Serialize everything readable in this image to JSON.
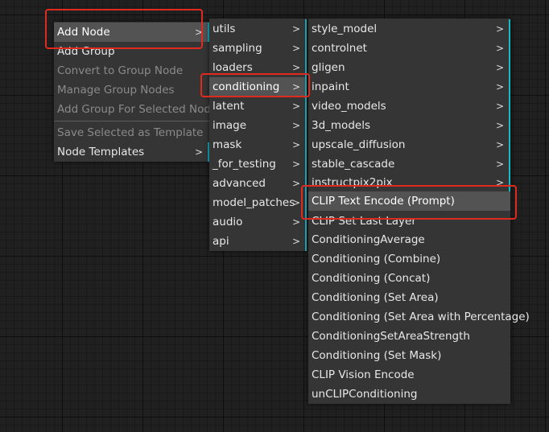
{
  "context_menu": {
    "items": [
      {
        "label": "Add Node",
        "arrow": ">"
      },
      {
        "label": "Add Group"
      },
      {
        "label": "Convert to Group Node"
      },
      {
        "label": "Manage Group Nodes"
      },
      {
        "label": "Add Group For Selected Nodes"
      },
      {
        "label": "Save Selected as Template"
      },
      {
        "label": "Node Templates",
        "arrow": ">"
      }
    ]
  },
  "add_node_menu": {
    "items": [
      {
        "label": "utils",
        "arrow": ">"
      },
      {
        "label": "sampling",
        "arrow": ">"
      },
      {
        "label": "loaders",
        "arrow": ">"
      },
      {
        "label": "conditioning",
        "arrow": ">"
      },
      {
        "label": "latent",
        "arrow": ">"
      },
      {
        "label": "image",
        "arrow": ">"
      },
      {
        "label": "mask",
        "arrow": ">"
      },
      {
        "label": "_for_testing",
        "arrow": ">"
      },
      {
        "label": "advanced",
        "arrow": ">"
      },
      {
        "label": "model_patches",
        "arrow": ">"
      },
      {
        "label": "audio",
        "arrow": ">"
      },
      {
        "label": "api",
        "arrow": ">"
      }
    ]
  },
  "conditioning_menu": {
    "submenus": [
      {
        "label": "style_model",
        "arrow": ">"
      },
      {
        "label": "controlnet",
        "arrow": ">"
      },
      {
        "label": "gligen",
        "arrow": ">"
      },
      {
        "label": "inpaint",
        "arrow": ">"
      },
      {
        "label": "video_models",
        "arrow": ">"
      },
      {
        "label": "3d_models",
        "arrow": ">"
      },
      {
        "label": "upscale_diffusion",
        "arrow": ">"
      },
      {
        "label": "stable_cascade",
        "arrow": ">"
      },
      {
        "label": "instructpix2pix",
        "arrow": ">"
      }
    ],
    "nodes": [
      {
        "label": "CLIP Text Encode (Prompt)"
      },
      {
        "label": "CLIP Set Last Layer"
      },
      {
        "label": "ConditioningAverage"
      },
      {
        "label": "Conditioning (Combine)"
      },
      {
        "label": "Conditioning (Concat)"
      },
      {
        "label": "Conditioning (Set Area)"
      },
      {
        "label": "Conditioning (Set Area with Percentage)"
      },
      {
        "label": "ConditioningSetAreaStrength"
      },
      {
        "label": "Conditioning (Set Mask)"
      },
      {
        "label": "CLIP Vision Encode"
      },
      {
        "label": "unCLIPConditioning"
      }
    ]
  },
  "colors": {
    "canvas_background": "#202020",
    "menu_background": "#353535",
    "submenu_indicator": "#16b8c9",
    "annotation_red": "#e02a1e"
  }
}
